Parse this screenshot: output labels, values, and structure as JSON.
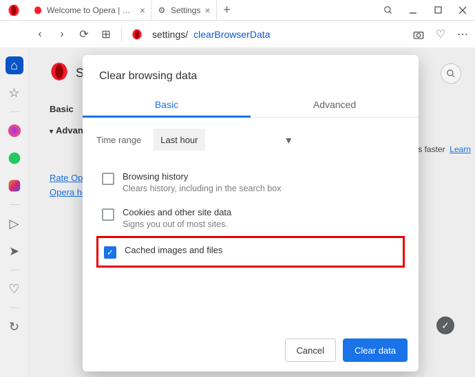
{
  "tabs": [
    {
      "label": "Welcome to Opera | Make"
    },
    {
      "label": "Settings"
    }
  ],
  "toolbar": {
    "address_prefix": "settings/",
    "address_path": "clearBrowserData"
  },
  "page": {
    "title_initial": "S",
    "nav": {
      "basic": "Basic",
      "advanced": "Advanced"
    },
    "links": {
      "rate": "Rate Oper",
      "help": "Opera hel"
    },
    "promo": {
      "text": "es faster",
      "link": "Learn"
    }
  },
  "dialog": {
    "title": "Clear browsing data",
    "tabs": {
      "basic": "Basic",
      "advanced": "Advanced"
    },
    "timerange_label": "Time range",
    "timerange_value": "Last hour",
    "options": [
      {
        "title": "Browsing history",
        "sub": "Clears history, including in the search box",
        "checked": false
      },
      {
        "title": "Cookies and other site data",
        "sub": "Signs you out of most sites.",
        "checked": false
      },
      {
        "title": "Cached images and files",
        "sub": "",
        "checked": true
      }
    ],
    "buttons": {
      "cancel": "Cancel",
      "confirm": "Clear data"
    }
  }
}
